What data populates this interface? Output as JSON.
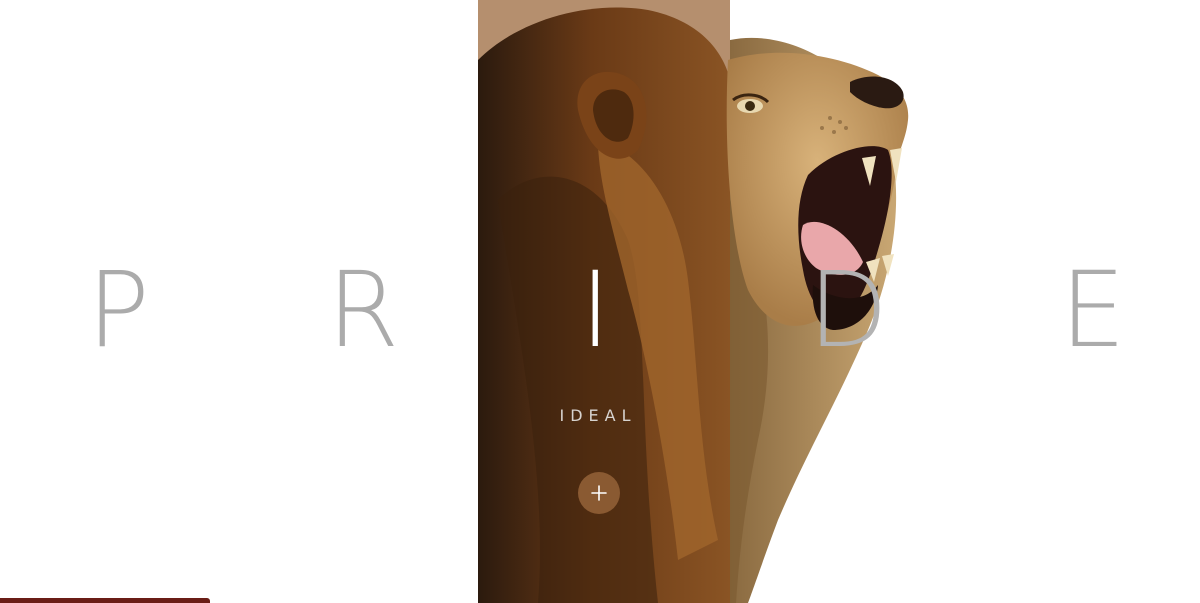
{
  "hero": {
    "letters": [
      "P",
      "R",
      "I",
      "D",
      "E"
    ],
    "subtitle": "IDEAL",
    "panel_color": "#b58f6e",
    "button_color": "#8a5a32",
    "button_icon": "plus-icon",
    "progress_color": "#6a1d16"
  }
}
